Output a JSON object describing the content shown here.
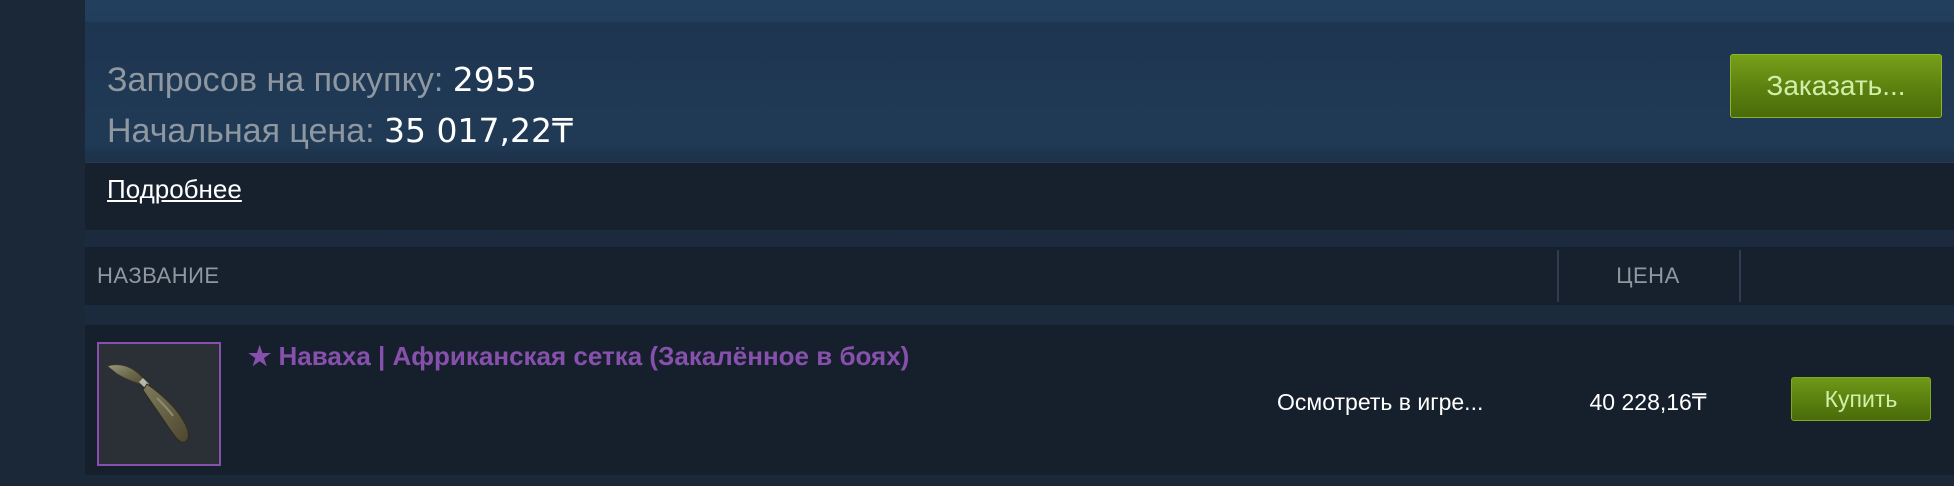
{
  "buy_order": {
    "requests_label": "Запросов на покупку: ",
    "requests_value": "2955",
    "start_price_label": "Начальная цена: ",
    "start_price_value": "35 017,22₸",
    "more_link": "Подробнее",
    "order_button": "Заказать..."
  },
  "table": {
    "header": {
      "name_label": "НАЗВАНИЕ",
      "price_label": "ЦЕНА"
    },
    "rows": [
      {
        "item_name": "★ Наваха | Африканская сетка (Закалённое в боях)",
        "item_icon": "navaja-knife-icon",
        "name_color": "#8650ac",
        "inspect_label": "Осмотреть в игре...",
        "price": "40 228,16₸",
        "buy_label": "Купить"
      }
    ]
  },
  "colors": {
    "accent_green": "#5c800f",
    "button_text": "#d2efa9",
    "background": "#1b2838"
  }
}
